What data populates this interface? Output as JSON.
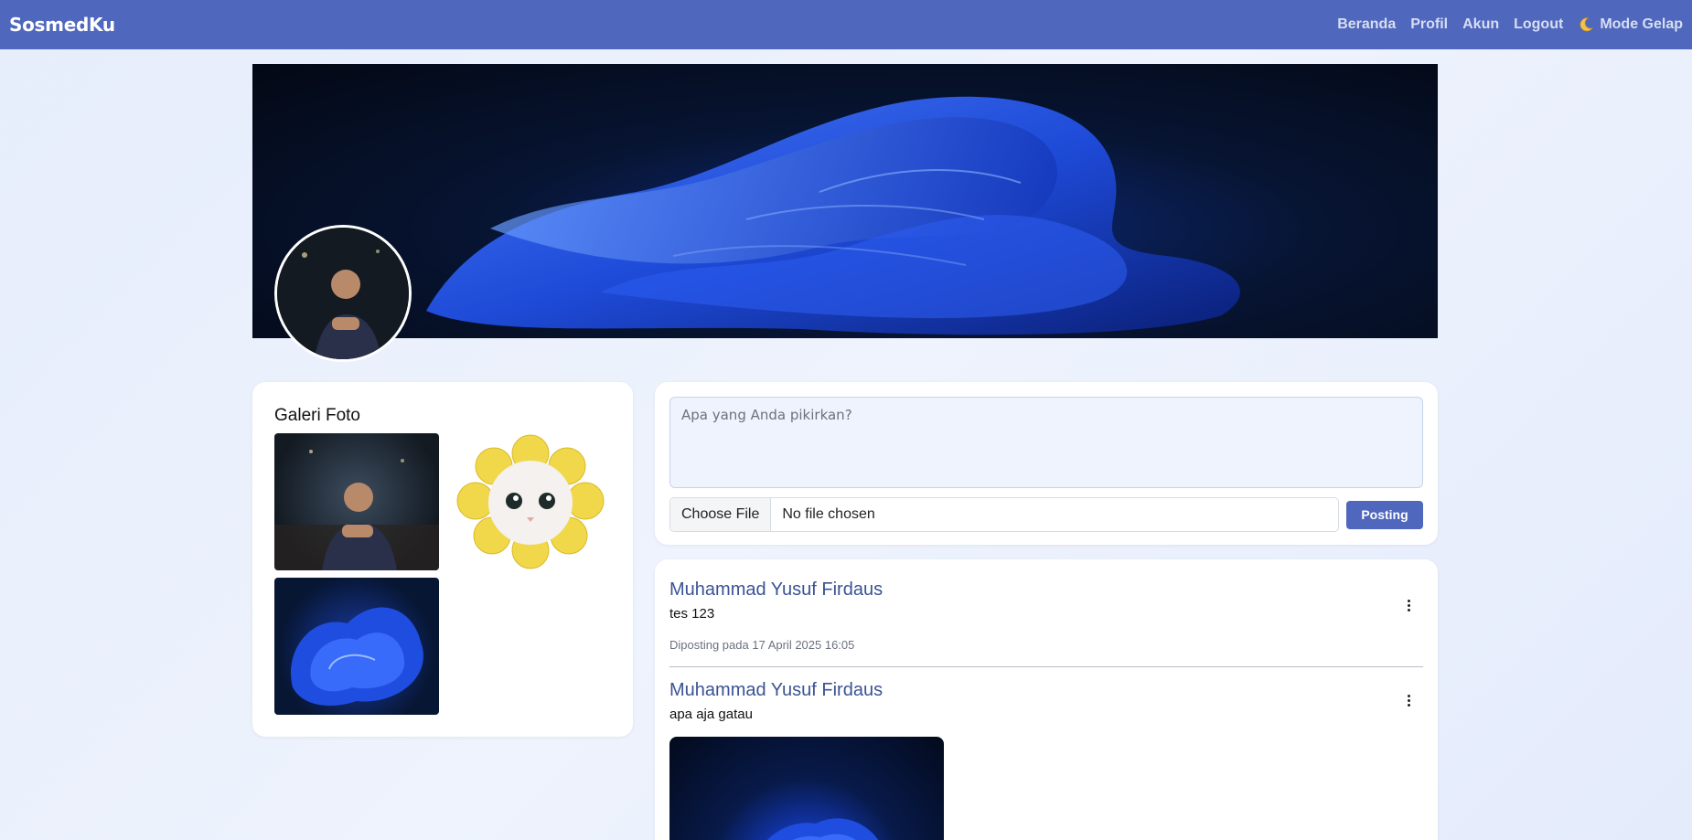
{
  "app": {
    "brand": "SosmedKu"
  },
  "nav": {
    "items": [
      {
        "label": "Beranda"
      },
      {
        "label": "Profil"
      },
      {
        "label": "Akun"
      },
      {
        "label": "Logout"
      }
    ],
    "dark_mode": {
      "label": "Mode Gelap",
      "icon": "moon-icon"
    }
  },
  "gallery": {
    "title": "Galeri Foto"
  },
  "composer": {
    "placeholder": "Apa yang Anda pikirkan?",
    "file_button": "Choose File",
    "file_status": "No file chosen",
    "submit_label": "Posting"
  },
  "posts": [
    {
      "author": "Muhammad Yusuf Firdaus",
      "text": "tes 123",
      "date": "Diposting pada 17 April 2025 16:05"
    },
    {
      "author": "Muhammad Yusuf Firdaus",
      "text": "apa aja gatau"
    }
  ],
  "colors": {
    "navbar": "#4f67bc",
    "accent": "#4f67bc",
    "author": "#3a5395"
  }
}
